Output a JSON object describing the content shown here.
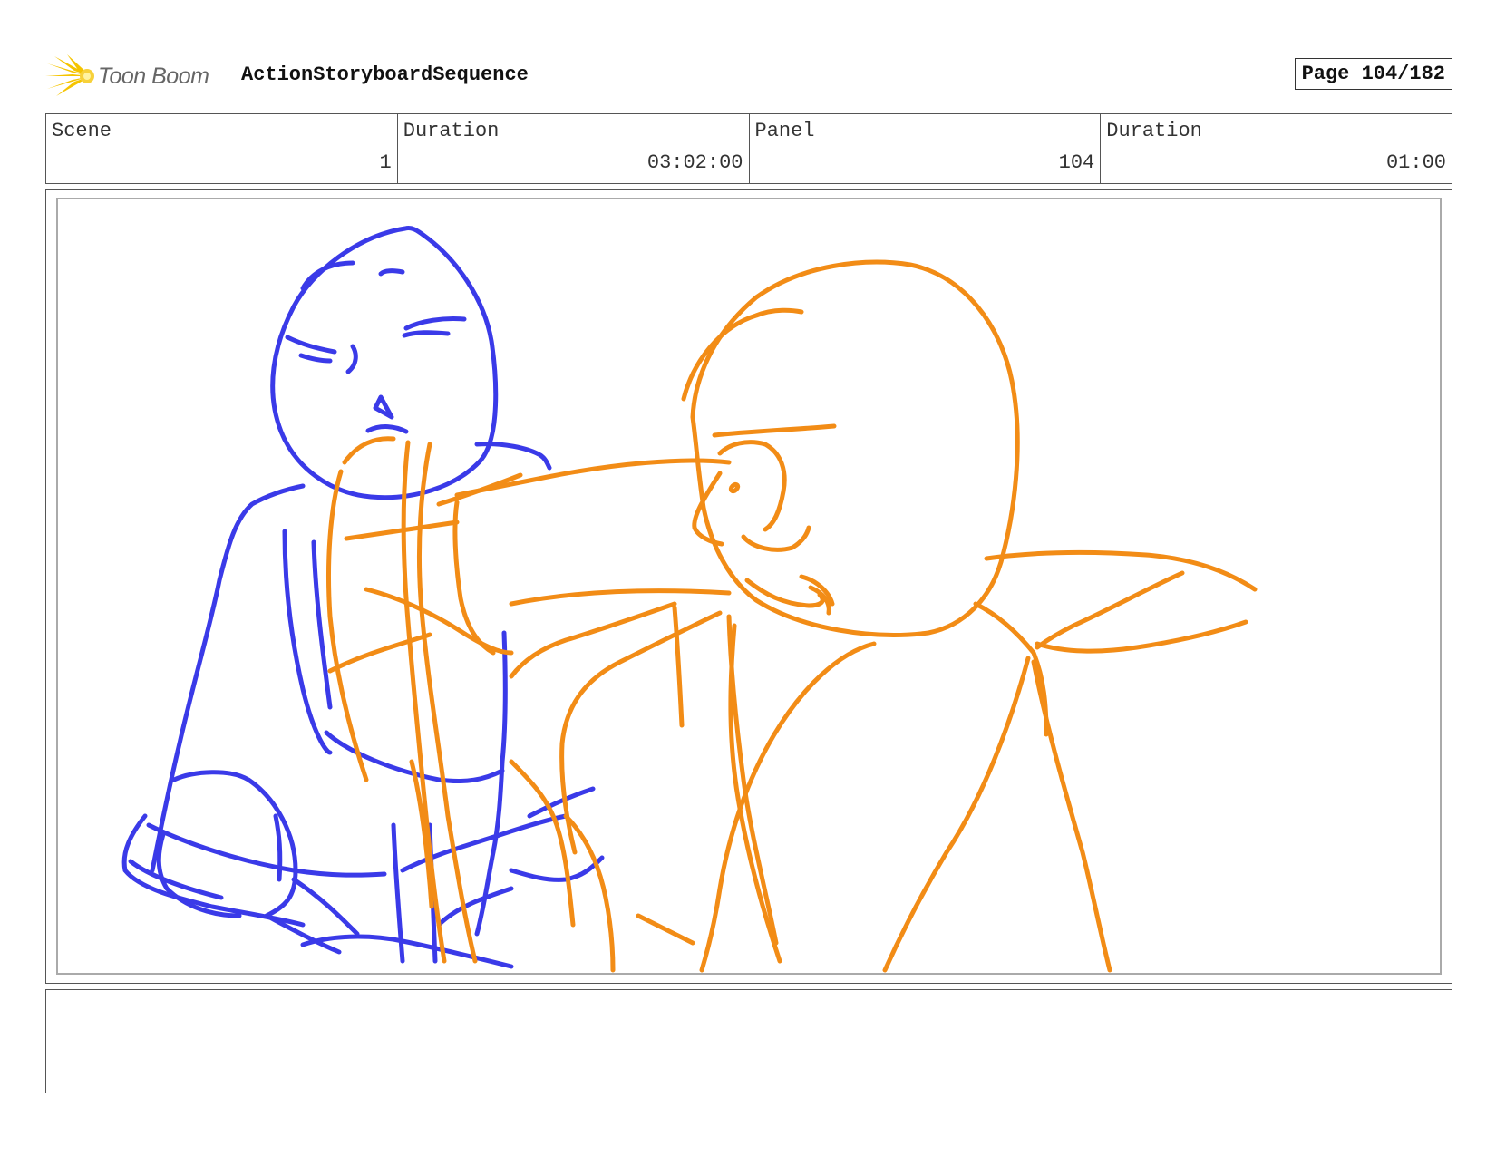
{
  "header": {
    "logo_text": "Toon Boom",
    "sequence_title": "ActionStoryboardSequence",
    "page_label": "Page 104/182"
  },
  "info": {
    "scene_label": "Scene",
    "scene_value": "1",
    "scene_duration_label": "Duration",
    "scene_duration_value": "03:02:00",
    "panel_label": "Panel",
    "panel_value": "104",
    "panel_duration_label": "Duration",
    "panel_duration_value": "01:00"
  },
  "sketch": {
    "blue_color": "#3a3ae8",
    "orange_color": "#f28c16"
  },
  "notes": {
    "text": ""
  }
}
